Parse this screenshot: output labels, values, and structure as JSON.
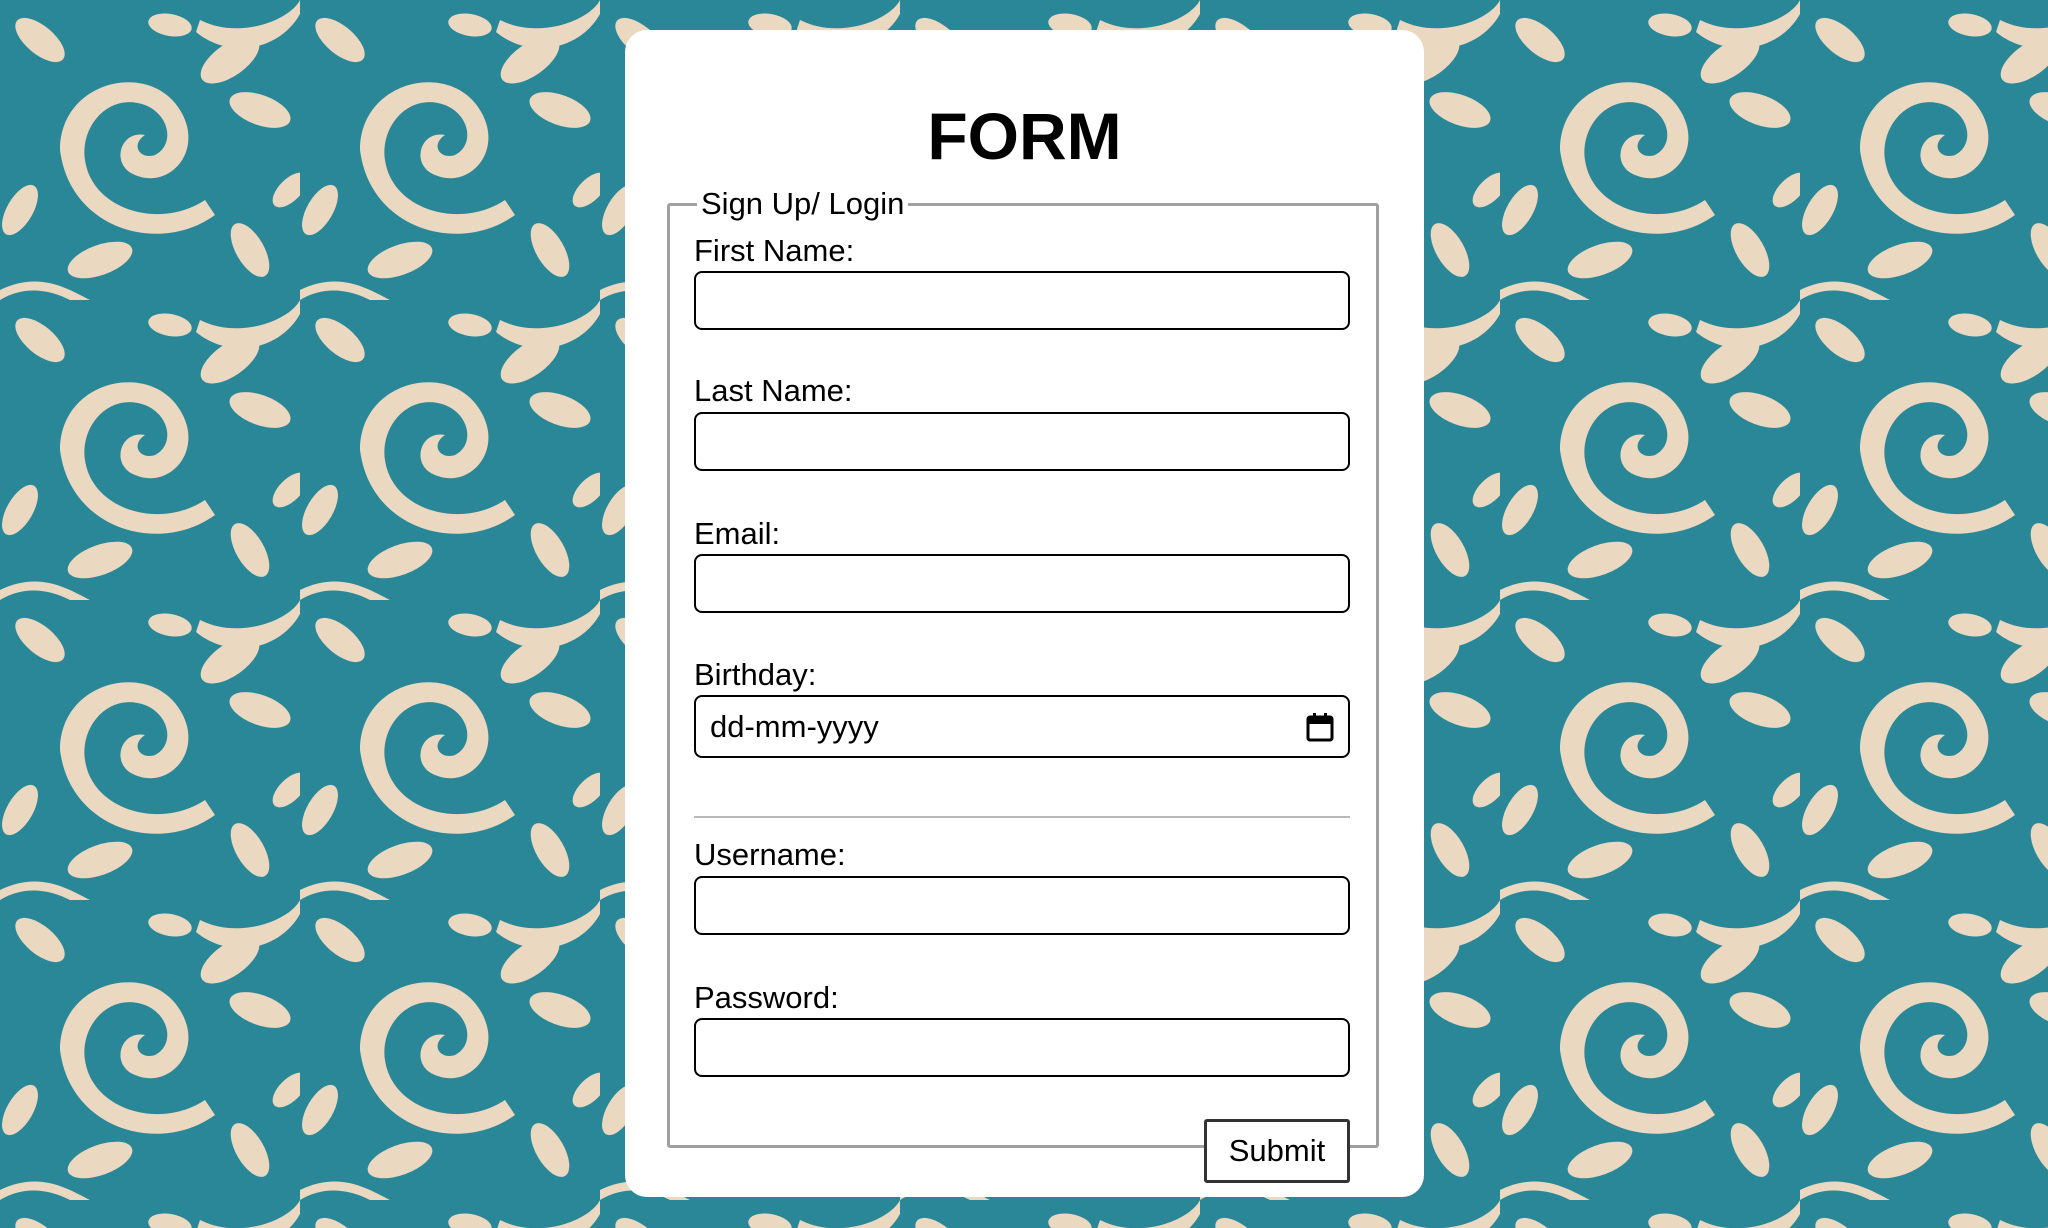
{
  "form": {
    "title": "FORM",
    "legend": "Sign Up/ Login",
    "fields": {
      "first_name": {
        "label": "First Name:",
        "value": ""
      },
      "last_name": {
        "label": "Last Name:",
        "value": ""
      },
      "email": {
        "label": "Email:",
        "value": ""
      },
      "birthday": {
        "label": "Birthday:",
        "placeholder": "dd-mm-yyyy",
        "icon": "calendar-icon"
      },
      "username": {
        "label": "Username:",
        "value": ""
      },
      "password": {
        "label": "Password:",
        "value": ""
      }
    },
    "submit_label": "Submit"
  },
  "colors": {
    "background_teal": "#2a8797",
    "pattern_cream": "#ead8c1",
    "card_white": "#ffffff"
  }
}
